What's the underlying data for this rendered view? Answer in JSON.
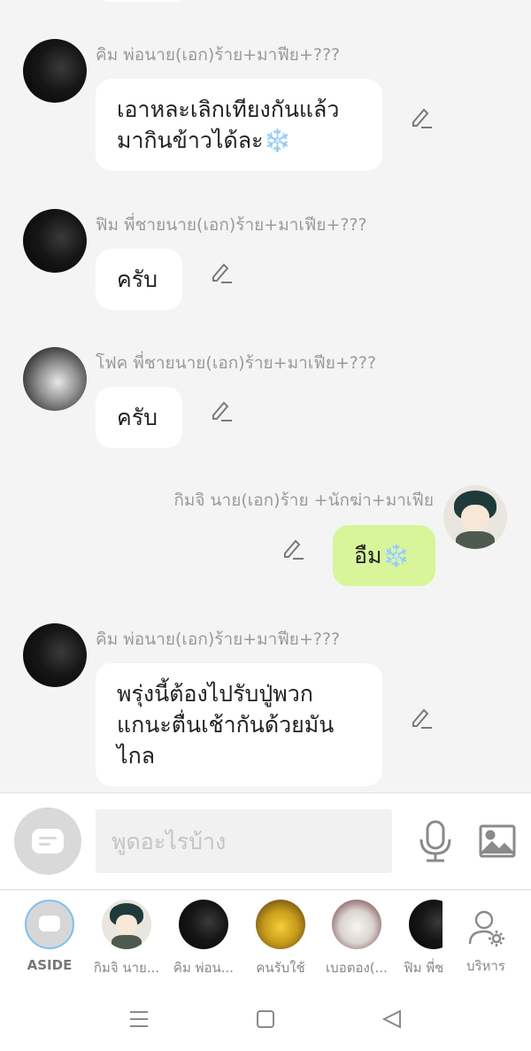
{
  "messages": [
    {
      "sender": "คิม พ่อนาย(เอก)ร้าย+มาฟีย+???",
      "lines": [
        "เอาหละเลิกเทียงกันแล้ว",
        "มากินข้าวได้ละ❄️"
      ],
      "mine": false
    },
    {
      "sender": "ฟิม พี่ชายนาย(เอก)ร้าย+มาเฟีย+???",
      "lines": [
        "ครับ"
      ],
      "mine": false
    },
    {
      "sender": "โฟค พี่ชายนาย(เอก)ร้าย+มาเฟีย+???",
      "lines": [
        "ครับ"
      ],
      "mine": false
    },
    {
      "sender": "กิมจิ นาย(เอก)ร้าย +นักฆ่า+มาเฟีย",
      "lines": [
        "อืม❄️"
      ],
      "mine": true
    },
    {
      "sender": "คิม พ่อนาย(เอก)ร้าย+มาฟีย+???",
      "lines": [
        "พรุ่งนี้ต้องไปรับปู่พวก",
        "แกนะตื่นเช้ากันด้วยมัน",
        "ไกล"
      ],
      "mine": false
    }
  ],
  "input": {
    "placeholder": "พูดอะไรบ้าง"
  },
  "characters": [
    {
      "label": "ASIDE",
      "icon": "chat-bubble-icon",
      "active": true
    },
    {
      "label": "กิมจิ นาย...",
      "icon": "avatar",
      "active": false
    },
    {
      "label": "คิม พ่อน...",
      "icon": "avatar",
      "active": false
    },
    {
      "label": "คนรับใช้",
      "icon": "avatar",
      "active": false
    },
    {
      "label": "เบอตอง(...",
      "icon": "avatar",
      "active": false
    },
    {
      "label": "ฟิม พี่ช",
      "icon": "avatar",
      "active": false
    }
  ],
  "admin": {
    "label": "บริหาร",
    "icon": "user-gear-icon"
  },
  "colors": {
    "my_bubble": "#d8f59a",
    "other_bubble": "#ffffff",
    "background": "#f4f4f4",
    "sender_text": "#9a9a9a"
  }
}
